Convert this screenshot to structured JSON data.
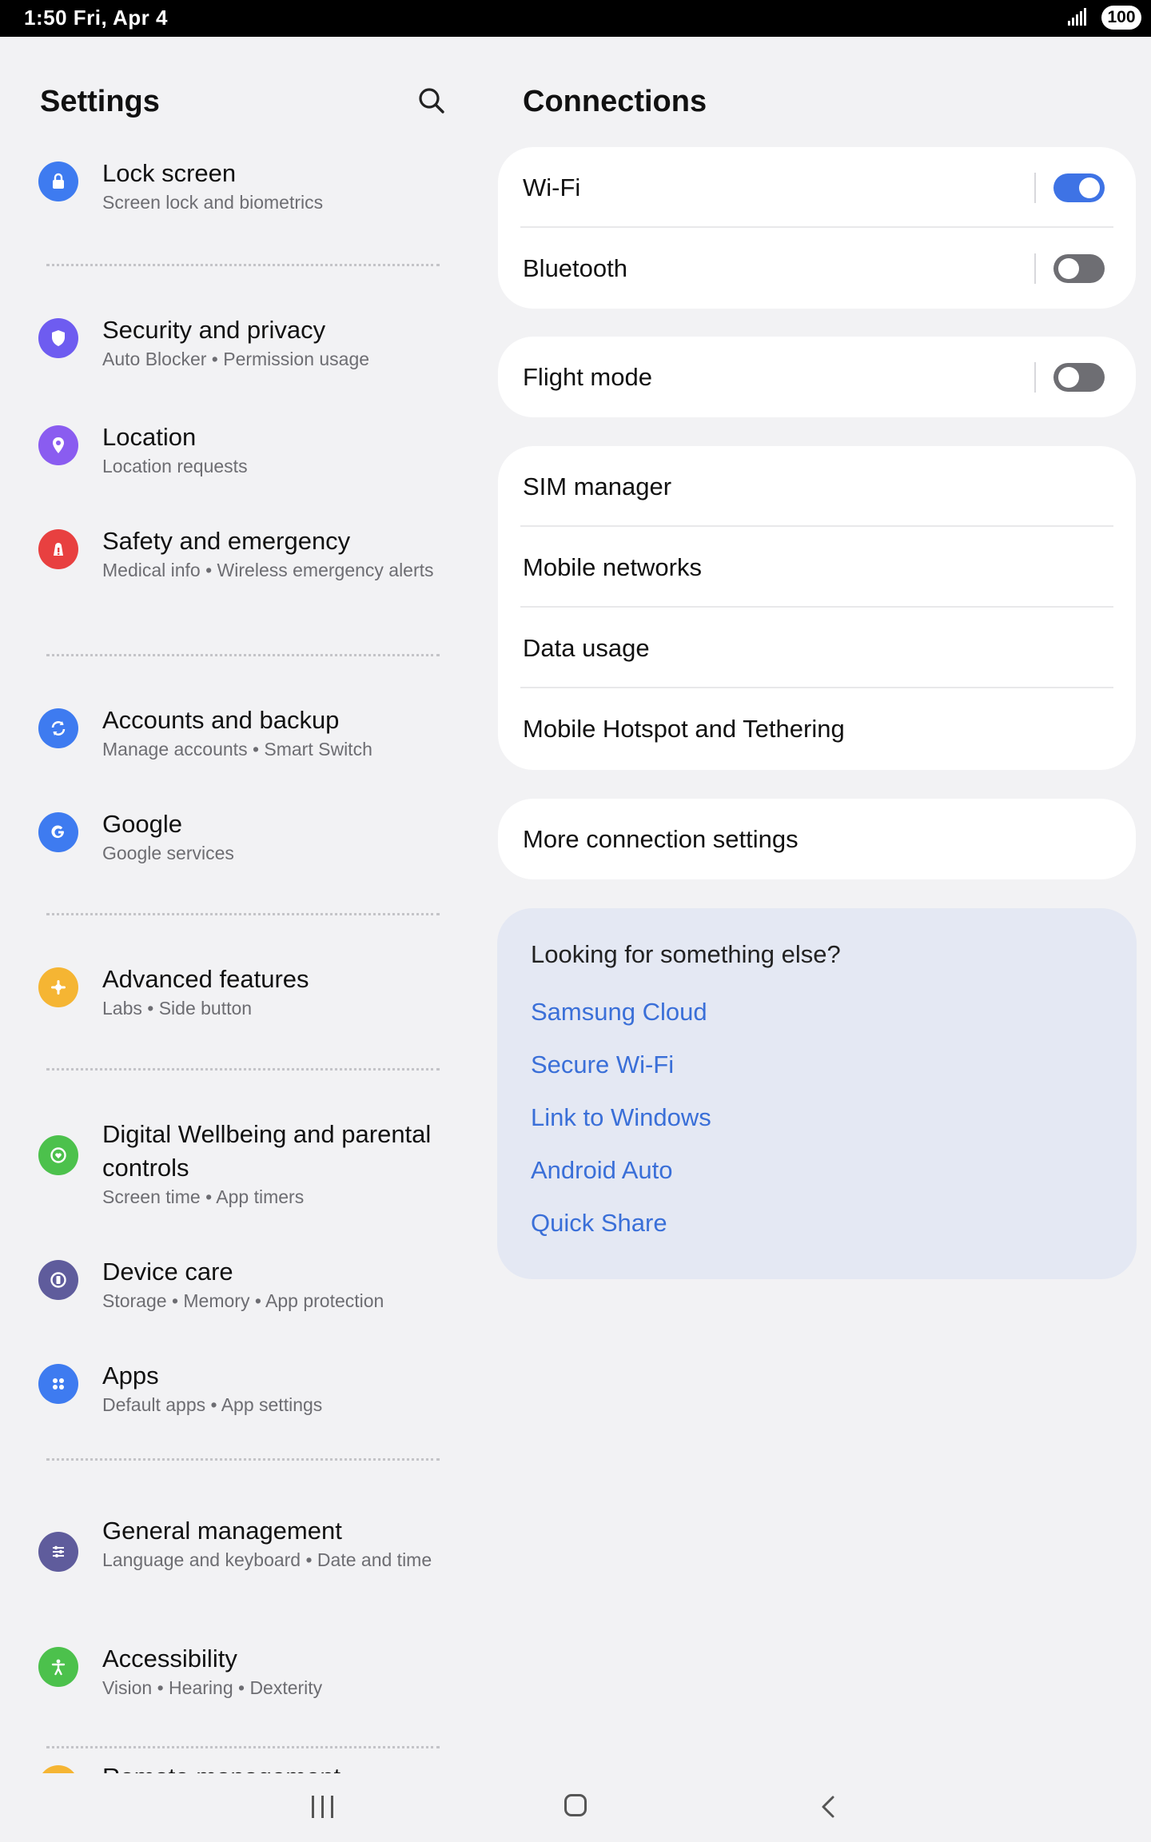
{
  "status_bar": {
    "time": "1:50  Fri, Apr 4",
    "battery": "100"
  },
  "left": {
    "title": "Settings",
    "items": [
      {
        "title": "Lock screen",
        "subtitle": "Screen lock and biometrics",
        "icon": "lock-icon",
        "color": "#3e7bf0"
      },
      {
        "title": "Security and privacy",
        "subtitle": "Auto Blocker  •  Permission usage",
        "icon": "shield-icon",
        "color": "#6e5cf0"
      },
      {
        "title": "Location",
        "subtitle": "Location requests",
        "icon": "location-pin-icon",
        "color": "#8a5cf0"
      },
      {
        "title": "Safety and emergency",
        "subtitle": "Medical info  •  Wireless emergency alerts",
        "icon": "emergency-icon",
        "color": "#e84040"
      },
      {
        "title": "Accounts and backup",
        "subtitle": "Manage accounts  •  Smart Switch",
        "icon": "sync-icon",
        "color": "#3e7bf0"
      },
      {
        "title": "Google",
        "subtitle": "Google services",
        "icon": "google-icon",
        "color": "#3e7bf0"
      },
      {
        "title": "Advanced features",
        "subtitle": "Labs  •  Side button",
        "icon": "puzzle-icon",
        "color": "#f5b533"
      },
      {
        "title": "Digital Wellbeing and parental controls",
        "subtitle": "Screen time  •  App timers",
        "icon": "wellbeing-icon",
        "color": "#4cc14c"
      },
      {
        "title": "Device care",
        "subtitle": "Storage  •  Memory  •  App protection",
        "icon": "device-care-icon",
        "color": "#5f5c9c"
      },
      {
        "title": "Apps",
        "subtitle": "Default apps  •  App settings",
        "icon": "apps-grid-icon",
        "color": "#3e7bf0"
      },
      {
        "title": "General management",
        "subtitle": "Language and keyboard  •  Date and time",
        "icon": "sliders-icon",
        "color": "#5f5c9c"
      },
      {
        "title": "Accessibility",
        "subtitle": "Vision  •  Hearing  •  Dexterity",
        "icon": "accessibility-icon",
        "color": "#4cc14c"
      },
      {
        "title": "Remote management",
        "subtitle": "",
        "icon": "remote-icon",
        "color": "#f5b533"
      }
    ]
  },
  "right": {
    "title": "Connections",
    "wifi": {
      "label": "Wi-Fi",
      "on": true
    },
    "bluetooth": {
      "label": "Bluetooth",
      "on": false
    },
    "flight": {
      "label": "Flight mode",
      "on": false
    },
    "sim_manager": "SIM manager",
    "mobile_networks": "Mobile networks",
    "data_usage": "Data usage",
    "hotspot": "Mobile Hotspot and Tethering",
    "more": "More connection settings",
    "suggest": {
      "heading": "Looking for something else?",
      "links": [
        "Samsung Cloud",
        "Secure Wi-Fi",
        "Link to Windows",
        "Android Auto",
        "Quick Share"
      ]
    }
  }
}
